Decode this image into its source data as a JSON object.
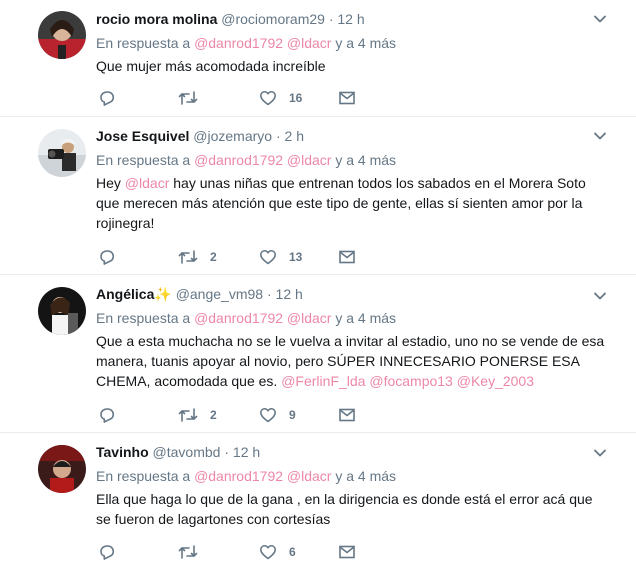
{
  "tweets": [
    {
      "name": "rocio mora molina",
      "handle": "@rociomoram29",
      "time": "12 h",
      "reply_prefix": "En respuesta a",
      "reply_to_1": "@danrod1792",
      "reply_to_2": "@ldacr",
      "reply_suffix": "y a 4 más",
      "text": "Que mujer más acomodada increíble",
      "replies": "",
      "retweets": "",
      "likes": "16"
    },
    {
      "name": "Jose Esquivel",
      "handle": "@jozemaryo",
      "time": "2 h",
      "reply_prefix": "En respuesta a",
      "reply_to_1": "@danrod1792",
      "reply_to_2": "@ldacr",
      "reply_suffix": "y a 4 más",
      "text_pre": "Hey ",
      "text_mention": "@ldacr",
      "text_post": " hay unas niñas que entrenan todos los sabados en el Morera Soto que merecen más atención que este tipo de gente, ellas sí sienten amor por la rojinegra!",
      "replies": "",
      "retweets": "2",
      "likes": "13"
    },
    {
      "name": "Angélica",
      "name_emoji": "✨",
      "handle": "@ange_vm98",
      "time": "12 h",
      "reply_prefix": "En respuesta a",
      "reply_to_1": "@danrod1792",
      "reply_to_2": "@ldacr",
      "reply_suffix": "y a 4 más",
      "text_pre": "Que a esta muchacha no se le vuelva a invitar al estadio, uno no se vende de esa manera, tuanis apoyar al novio, pero SÚPER INNECESARIO PONERSE ESA CHEMA, acomodada que es. ",
      "text_mention_1": "@FerlinF_lda",
      "text_mention_2": "@focampo13",
      "text_mention_3": "@Key_2003",
      "replies": "",
      "retweets": "2",
      "likes": "9"
    },
    {
      "name": "Tavinho",
      "handle": "@tavombd",
      "time": "12 h",
      "reply_prefix": "En respuesta a",
      "reply_to_1": "@danrod1792",
      "reply_to_2": "@ldacr",
      "reply_suffix": "y a 4 más",
      "text": "Ella que haga lo que de la gana , en la dirigencia es donde está el error acá que se fueron de lagartones con cortesías",
      "replies": "",
      "retweets": "",
      "likes": "6"
    }
  ],
  "colors": {
    "text": "#14171a",
    "muted": "#657786",
    "mention": "#e0245e",
    "link": "#1da1f2",
    "divider": "#e6ecf0",
    "sparkle": "#f5c518"
  },
  "icons": {
    "reply": "reply-icon",
    "retweet": "retweet-icon",
    "like": "heart-icon",
    "dm": "envelope-icon",
    "menu": "chevron-down-icon"
  }
}
